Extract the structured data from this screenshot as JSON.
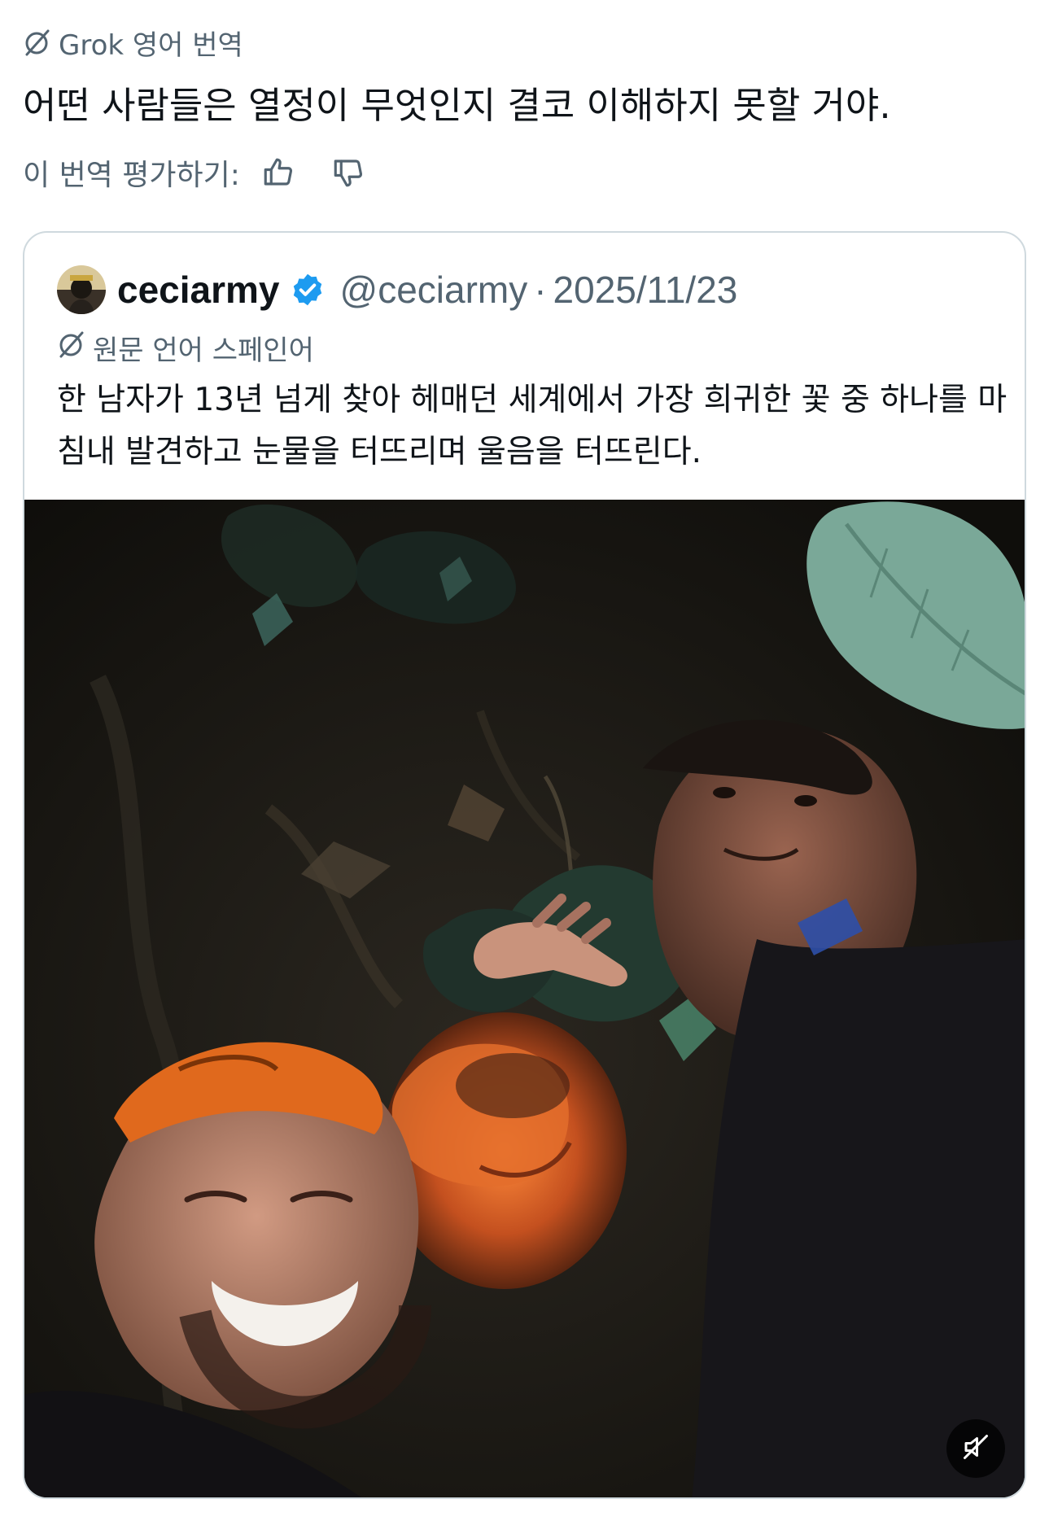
{
  "translation": {
    "header_label": "Grok 영어 번역",
    "text": "어떤 사람들은 열정이 무엇인지 결코 이해하지 못할 거야.",
    "rate_label": "이 번역 평가하기:",
    "thumb_up_icon": "thumb-up-icon",
    "thumb_down_icon": "thumb-down-icon"
  },
  "quote": {
    "display_name": "ceciarmy",
    "handle": "@ceciarmy",
    "separator": "·",
    "date": "2025/11/23",
    "verified_icon": "verified-badge-icon",
    "original_language_label": "원문 언어 스페인어",
    "text": "한 남자가 13년 넘게 찾아 헤매던 세계에서 가장 희귀한 꽃 중 하나를 마침내 발견하고 눈물을 터뜨리며 울음을 터뜨린다.",
    "media": {
      "type": "video",
      "mute_icon": "muted-speaker-icon"
    }
  },
  "colors": {
    "text_primary": "#0f1419",
    "text_secondary": "#536471",
    "border": "#cfd9de",
    "verified_blue": "#1d9bf0"
  }
}
